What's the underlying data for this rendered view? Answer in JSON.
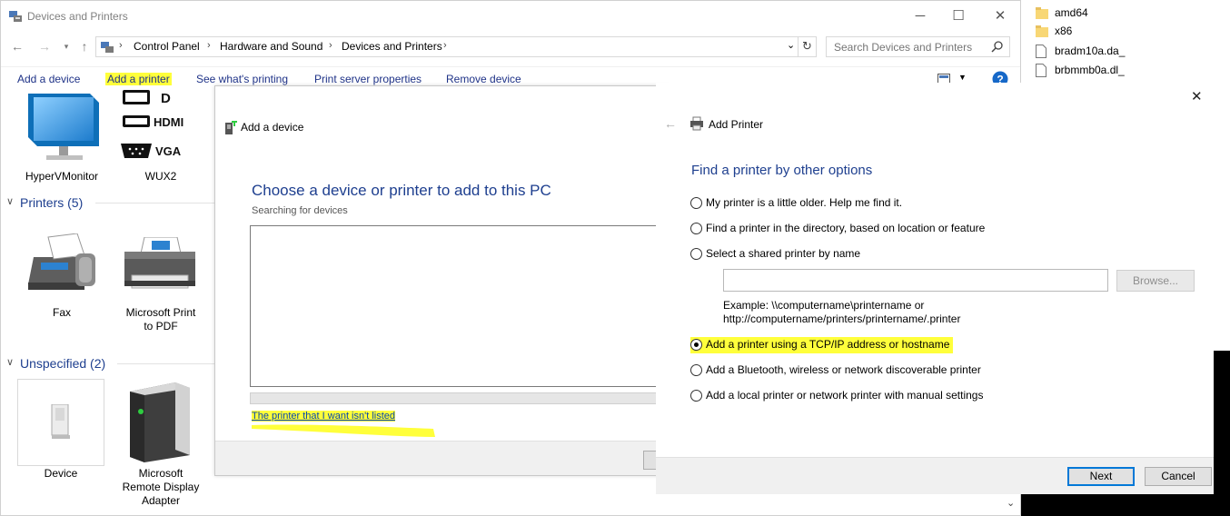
{
  "window": {
    "title": "Devices and Printers",
    "controls": {
      "minimize": "─",
      "maximize": "☐",
      "close": "✕"
    }
  },
  "address": {
    "crumbs": [
      "Control Panel",
      "Hardware and Sound",
      "Devices and Printers"
    ],
    "search_placeholder": "Search Devices and Printers"
  },
  "commands": {
    "add_device": "Add a device",
    "add_printer": "Add a printer",
    "whats_printing": "See what's printing",
    "print_server": "Print server properties",
    "remove_device": "Remove device"
  },
  "devices": {
    "monitor_label": "HyperVMonitor",
    "wux2_label": "WUX2",
    "port_labels": [
      "HDMI",
      "VGA"
    ],
    "printers_group": "Printers (5)",
    "fax_label": "Fax",
    "pdf_label_line1": "Microsoft Print",
    "pdf_label_line2": "to PDF",
    "unspecified_group": "Unspecified (2)",
    "device_label": "Device",
    "rda_label_line1": "Microsoft",
    "rda_label_line2": "Remote Display",
    "rda_label_line3": "Adapter"
  },
  "add_device_dialog": {
    "title": "Add a device",
    "heading": "Choose a device or printer to add to this PC",
    "status": "Searching for devices",
    "link": "The printer that I want isn't listed"
  },
  "add_printer_dialog": {
    "title": "Add Printer",
    "heading": "Find a printer by other options",
    "options": [
      "My printer is a little older. Help me find it.",
      "Find a printer in the directory, based on location or feature",
      "Select a shared printer by name",
      "Add a printer using a TCP/IP address or hostname",
      "Add a Bluetooth, wireless or network discoverable printer",
      "Add a local printer or network printer with manual settings"
    ],
    "selected_option": 3,
    "browse": "Browse...",
    "example_line1": "Example: \\\\computername\\printername or",
    "example_line2": "http://computername/printers/printername/.printer",
    "next": "Next",
    "cancel": "Cancel"
  },
  "files": [
    "amd64",
    "x86",
    "bradm10a.da_",
    "brbmmb0a.dl_"
  ],
  "colors": {
    "highlight": "#ffff3b",
    "link": "#1e3287",
    "heading": "#1e3f8f"
  }
}
